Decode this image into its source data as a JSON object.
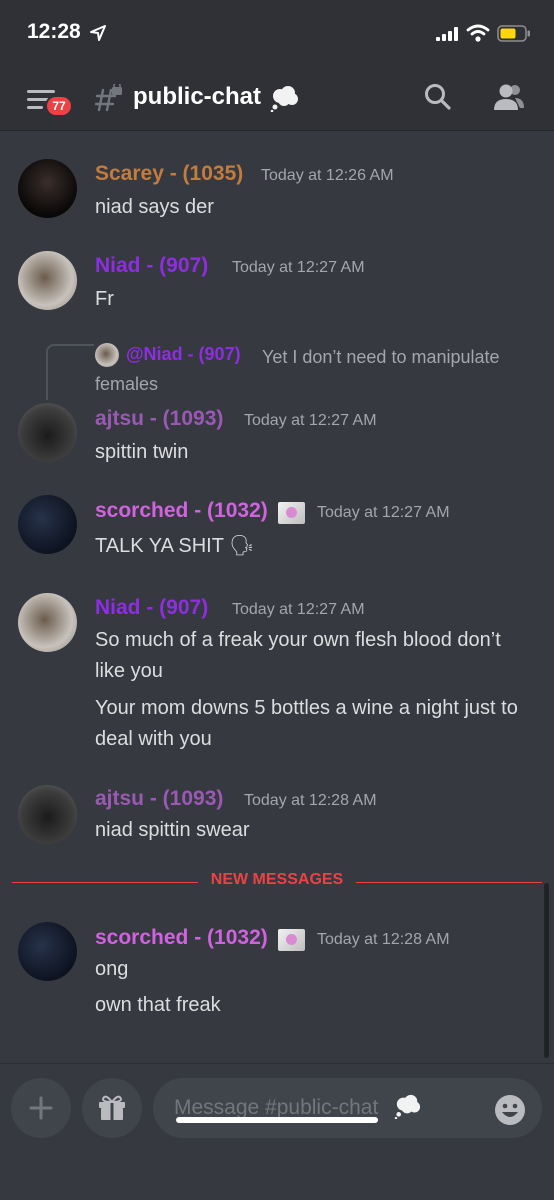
{
  "status_bar": {
    "time": "12:28"
  },
  "header": {
    "badge_count": "77",
    "channel_name": "public-chat"
  },
  "messages": [
    {
      "author": "Scarey - (1035)",
      "timestamp": "Today at 12:26 AM",
      "lines": [
        "niad says der"
      ]
    },
    {
      "author": "Niad - (907)",
      "timestamp": "Today at 12:27 AM",
      "lines": [
        "Fr"
      ]
    },
    {
      "reply": {
        "author": "@Niad - (907)",
        "text": "Yet I don’t need to manipulate females"
      },
      "author": "ajtsu - (1093)",
      "timestamp": "Today at 12:27 AM",
      "lines": [
        "spittin twin"
      ]
    },
    {
      "author": "scorched - (1032)",
      "timestamp": "Today at 12:27 AM",
      "lines": [
        "TALK YA SHIT 🗣"
      ]
    },
    {
      "author": "Niad - (907)",
      "timestamp": "Today at 12:27 AM",
      "lines": [
        "So much of a freak your own flesh blood don’t like you",
        "Your mom downs 5 bottles a wine a night just to deal with you"
      ]
    },
    {
      "author": "ajtsu - (1093)",
      "timestamp": "Today at 12:28 AM",
      "lines": [
        "niad spittin swear"
      ]
    },
    {
      "author": "scorched - (1032)",
      "timestamp": "Today at 12:28 AM",
      "lines": [
        "ong",
        "own that freak"
      ]
    }
  ],
  "divider_label": "NEW MESSAGES",
  "composer": {
    "placeholder": "Message #public-chat"
  },
  "colors": {
    "background": "#36393f",
    "header": "#2f3136",
    "accent_red": "#ed4245",
    "scarey_role": "#c27c3e",
    "niad_role": "#8e2de2",
    "ajtsu_role": "#9b59b6",
    "scorched_role": "#d162e0"
  },
  "icons": [
    "location-arrow-icon",
    "signal-icon",
    "wifi-icon",
    "battery-icon",
    "menu-icon",
    "locked-hash-icon",
    "thought-cloud-icon",
    "search-icon",
    "members-icon",
    "plus-icon",
    "gift-icon",
    "emoji-icon"
  ]
}
